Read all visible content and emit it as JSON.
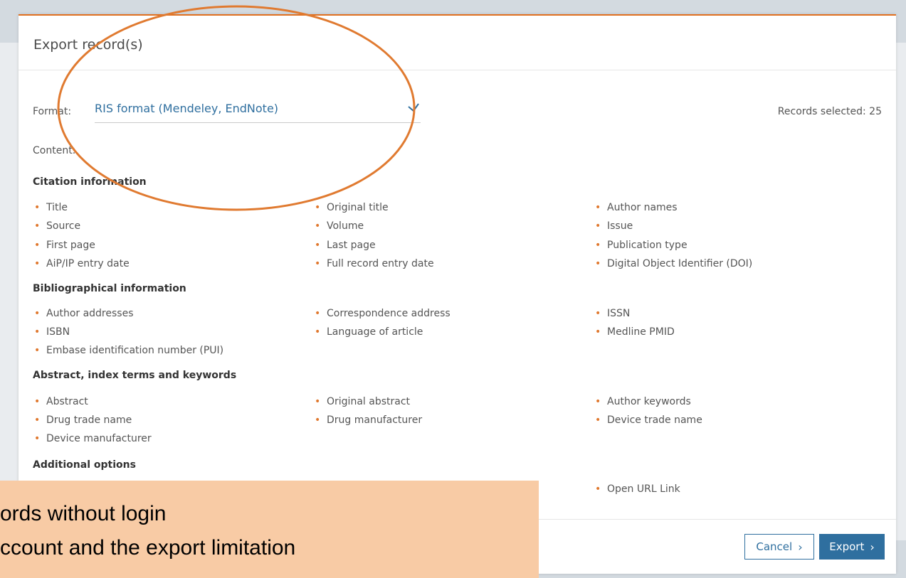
{
  "modal": {
    "title": "Export record(s)",
    "format_label": "Format:",
    "format_value": "RIS format (Mendeley, EndNote)",
    "records_selected": "Records selected: 25",
    "content_label": "Content:"
  },
  "sections": {
    "citation": {
      "heading": "Citation information",
      "items": [
        "Title",
        "Original title",
        "Author names",
        "Source",
        "Volume",
        "Issue",
        "First page",
        "Last page",
        "Publication type",
        "AiP/IP entry date",
        "Full record entry date",
        "Digital Object Identifier (DOI)"
      ]
    },
    "bibliographical": {
      "heading": "Bibliographical information",
      "items": [
        "Author addresses",
        "Correspondence address",
        "ISSN",
        "ISBN",
        "Language of article",
        "Medline PMID",
        "Embase identification number (PUI)"
      ]
    },
    "abstract": {
      "heading": "Abstract, index terms and keywords",
      "items": [
        "Abstract",
        "Original abstract",
        "Author keywords",
        "Drug trade name",
        "Drug manufacturer",
        "Device trade name",
        "Device manufacturer"
      ]
    },
    "additional": {
      "heading": "Additional options",
      "items": [
        "Open URL Link"
      ]
    }
  },
  "footer": {
    "cancel_label": "Cancel",
    "export_label": "Export",
    "arrow": "›"
  },
  "callout": {
    "line1": "ords without login",
    "line2": "ccount and the export limitation"
  },
  "colors": {
    "accent": "#e07020",
    "link_blue": "#2f6f9f",
    "callout_bg": "#f8cba5"
  }
}
